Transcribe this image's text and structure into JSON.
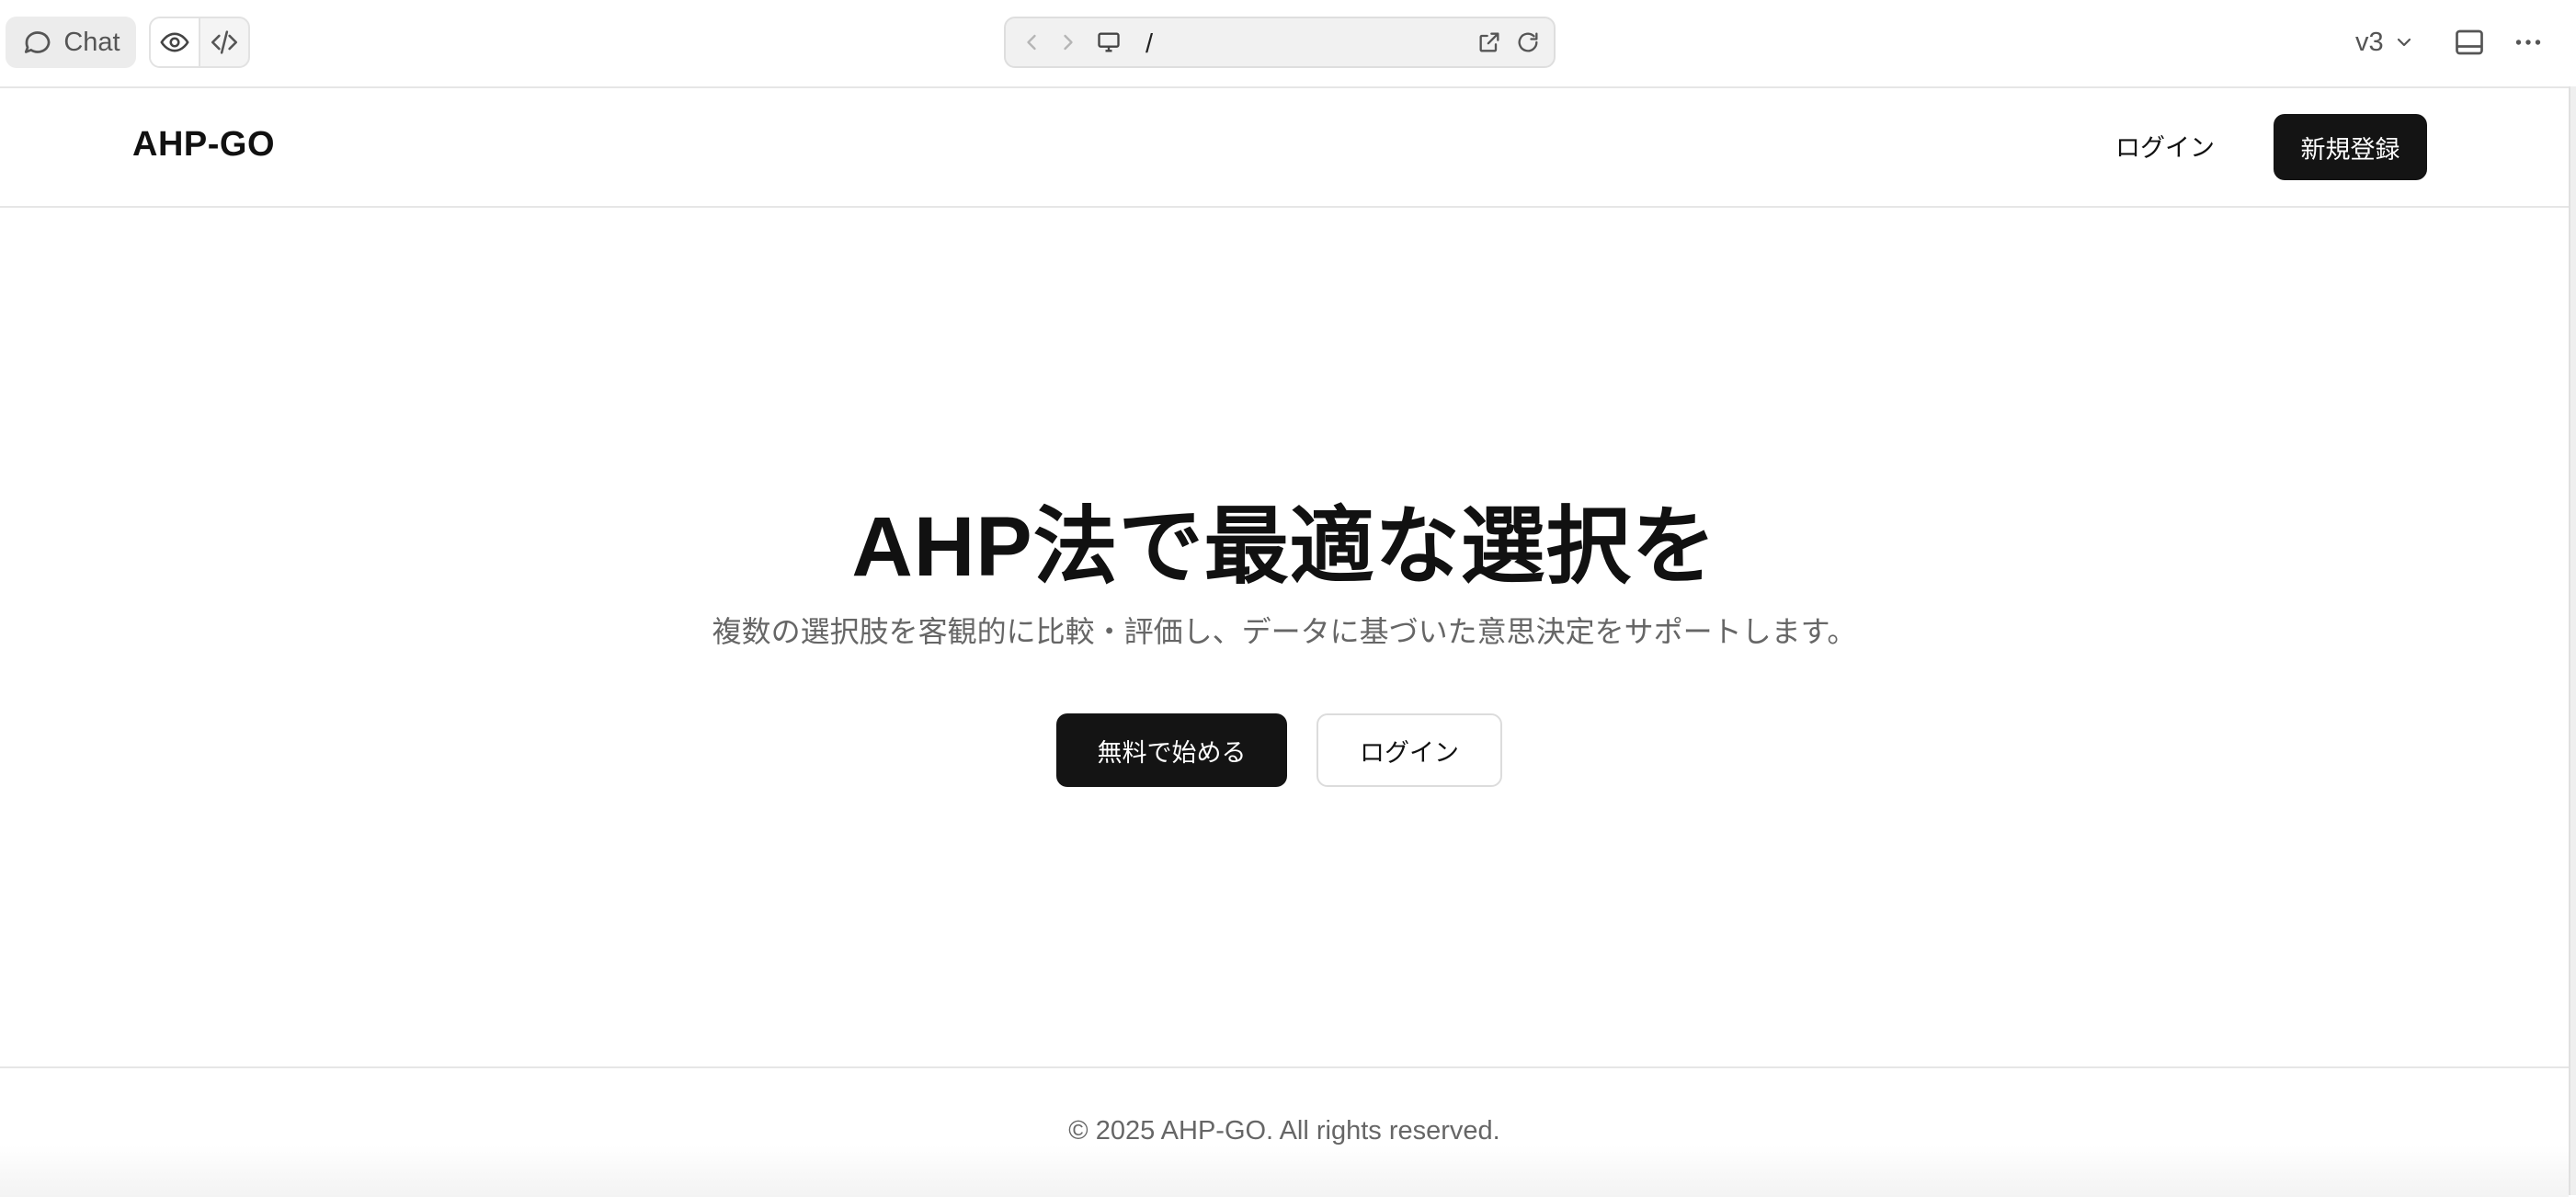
{
  "toolbar": {
    "chat_label": "Chat",
    "url_path": "/",
    "version_label": "v3"
  },
  "header": {
    "logo": "AHP-GO",
    "login_label": "ログイン",
    "signup_label": "新規登録"
  },
  "hero": {
    "title": "AHP法で最適な選択を",
    "subtitle": "複数の選択肢を客観的に比較・評価し、データに基づいた意思決定をサポートします。",
    "primary_cta": "無料で始める",
    "secondary_cta": "ログイン"
  },
  "footer": {
    "copyright": "© 2025 AHP-GO. All rights reserved."
  },
  "colors": {
    "primary_button": "#141414",
    "muted_text": "#666666",
    "border": "#e6e6e6"
  },
  "icons": [
    "chat-bubble-icon",
    "eye-icon",
    "code-icon",
    "back-arrow-icon",
    "forward-arrow-icon",
    "monitor-icon",
    "external-link-icon",
    "refresh-icon",
    "chevron-down-icon",
    "panel-icon",
    "more-icon"
  ]
}
